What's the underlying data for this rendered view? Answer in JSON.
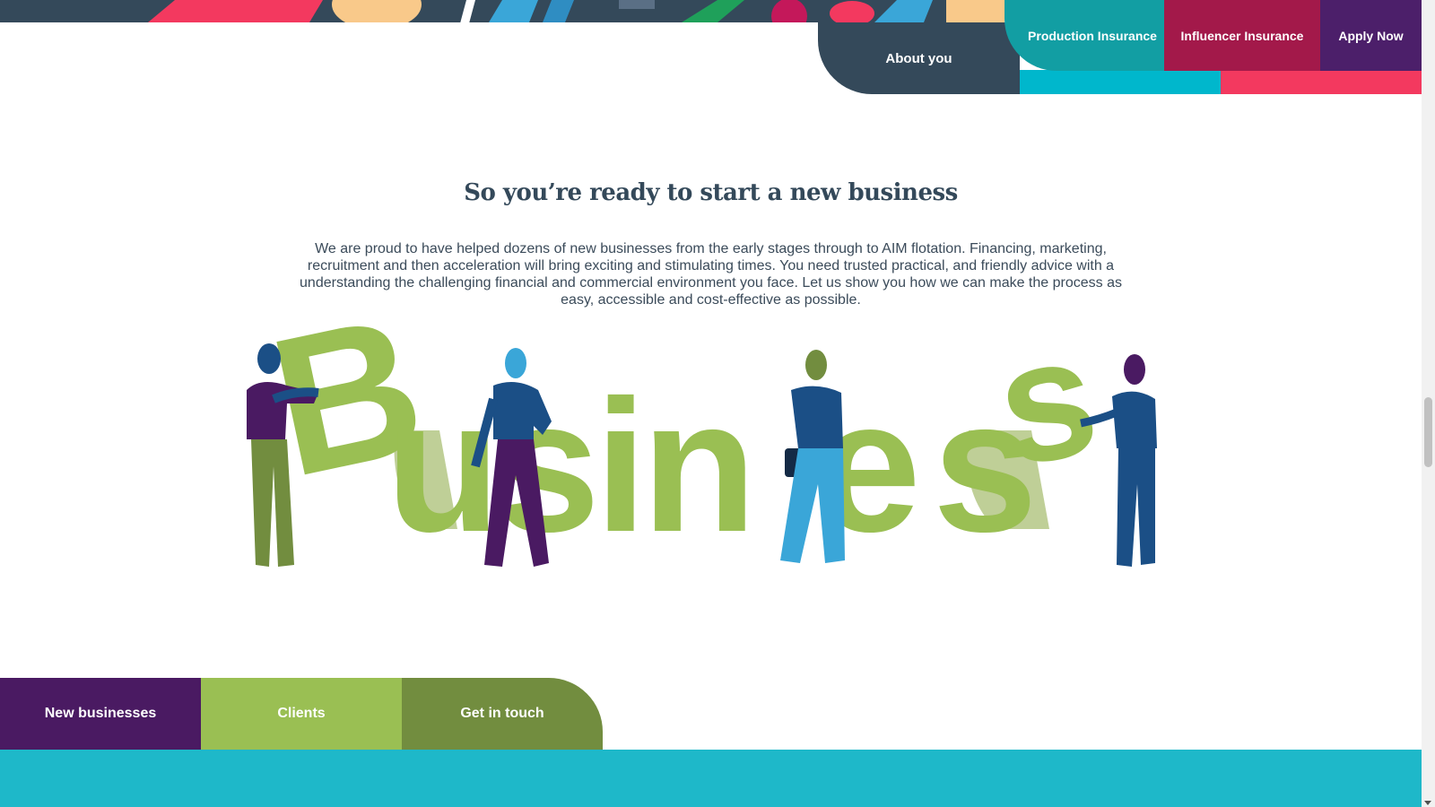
{
  "nav": {
    "about": "About you",
    "production": "Production Insurance",
    "influencer": "Influencer Insurance",
    "apply": "Apply Now"
  },
  "intro": {
    "title": "So you’re ready to start a new business",
    "body": "We are proud to have helped dozens of new businesses from the early stages through to AIM flotation. Financing, marketing, recruitment and then acceleration will bring exciting and stimulating times. You need trusted practical, and friendly advice with a understanding the challenging financial and commercial environment you face. Let us show you how we can make the process as easy, accessible and cost-effective as possible."
  },
  "illustration": {
    "word": "Business"
  },
  "bottom_tabs": {
    "new_businesses": "New businesses",
    "clients": "Clients",
    "contact": "Get in touch"
  },
  "colors": {
    "navy": "#34495a",
    "teal": "#129ea3",
    "crimson": "#a3194a",
    "purple": "#4c1f6a",
    "green": "#9abf53",
    "olive": "#728d3f",
    "cyan": "#1eb8c9",
    "pink": "#f3395f"
  }
}
